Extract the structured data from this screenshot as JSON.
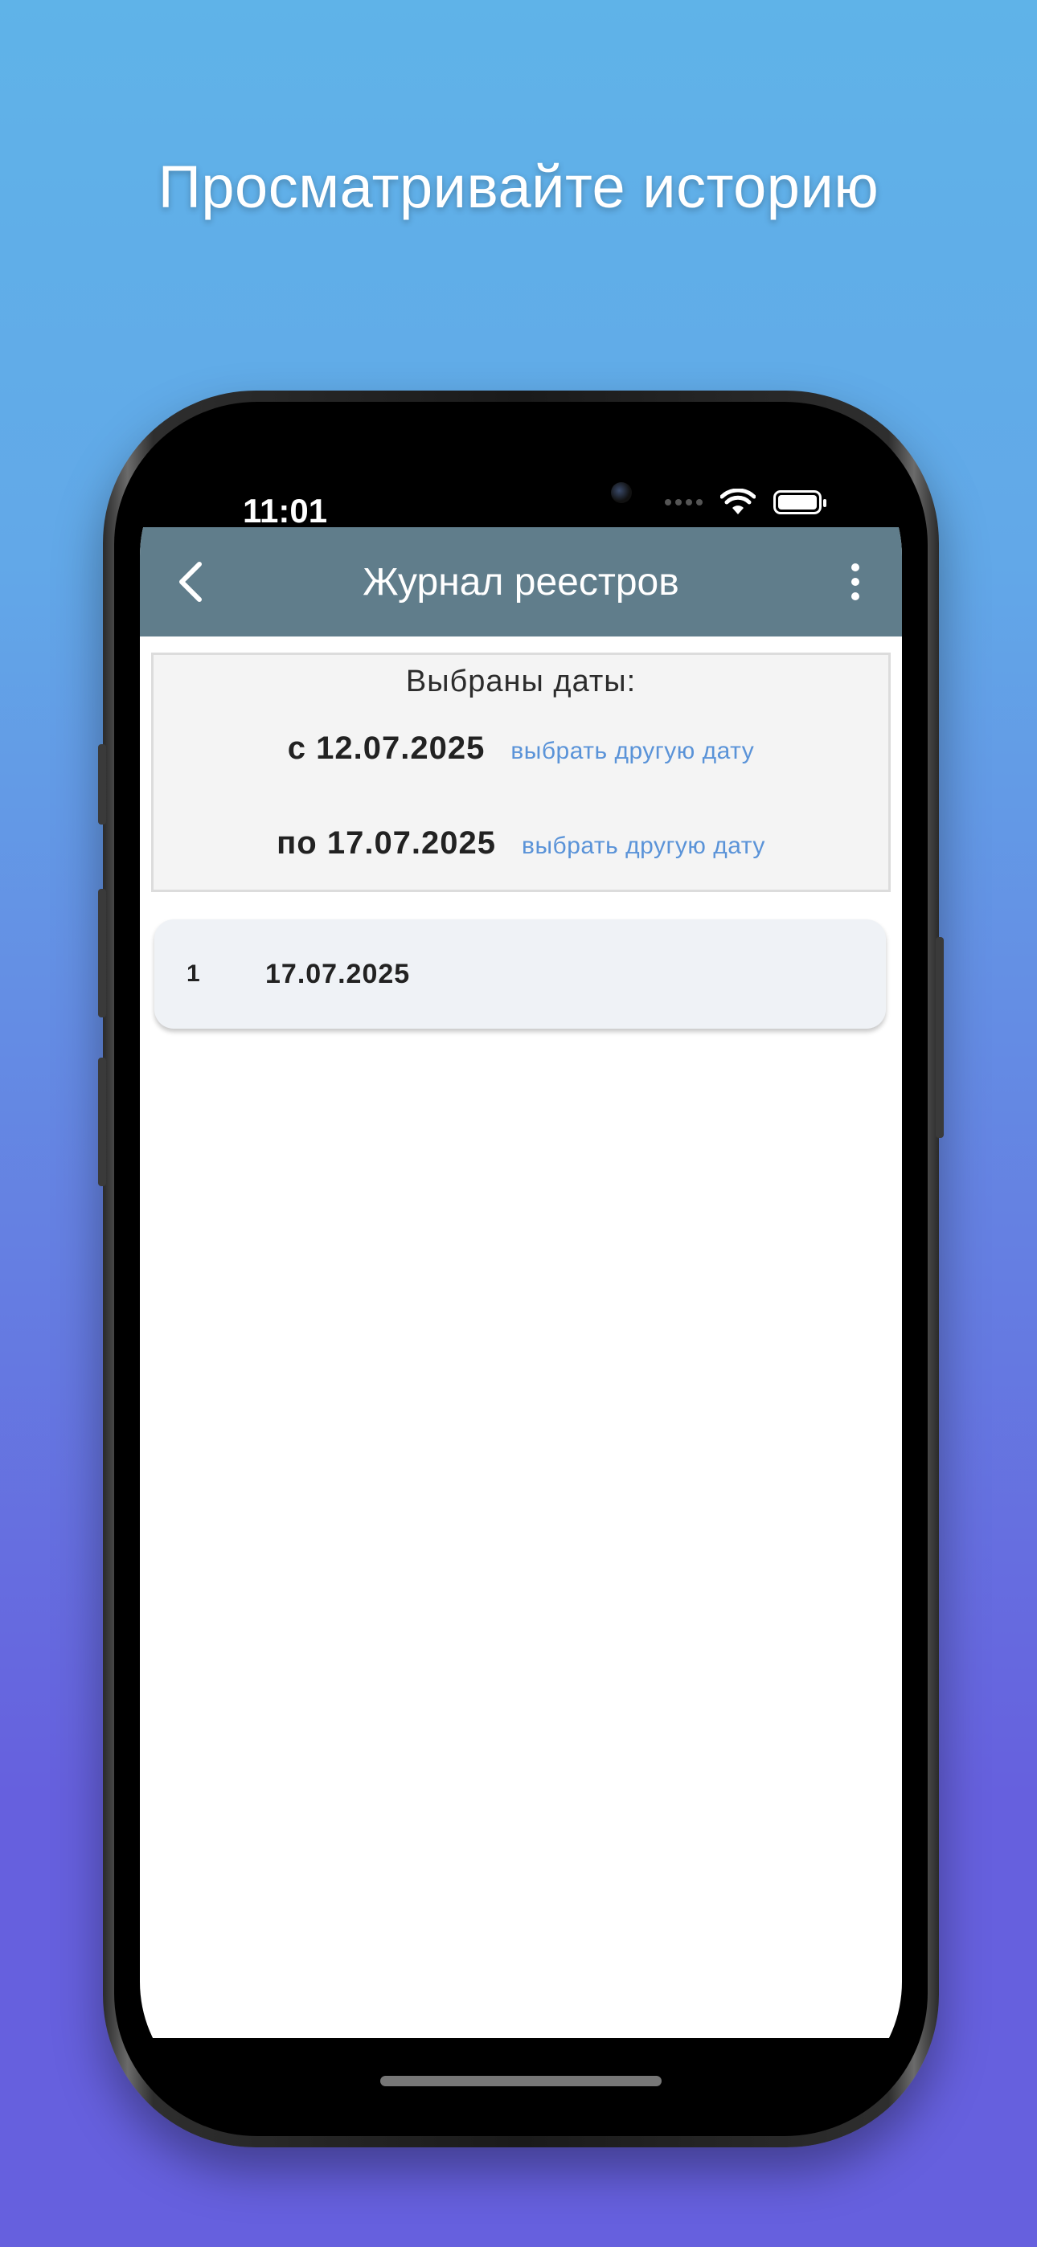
{
  "headline": "Просматривайте историю",
  "status_bar": {
    "time": "11:01"
  },
  "appbar": {
    "title": "Журнал реестров",
    "back_icon": "chevron-left-icon",
    "menu_icon": "more-vertical-icon"
  },
  "date_selection": {
    "label": "Выбраны даты:",
    "from_value": "с 12.07.2025",
    "from_link": "выбрать другую дату",
    "to_value": "по 17.07.2025",
    "to_link": "выбрать другую дату"
  },
  "registry_list": [
    {
      "index": "1",
      "date": "17.07.2025"
    }
  ],
  "colors": {
    "appbar": "#607d8b",
    "link": "#5a93d8",
    "list_item_bg": "#eff2f6"
  }
}
